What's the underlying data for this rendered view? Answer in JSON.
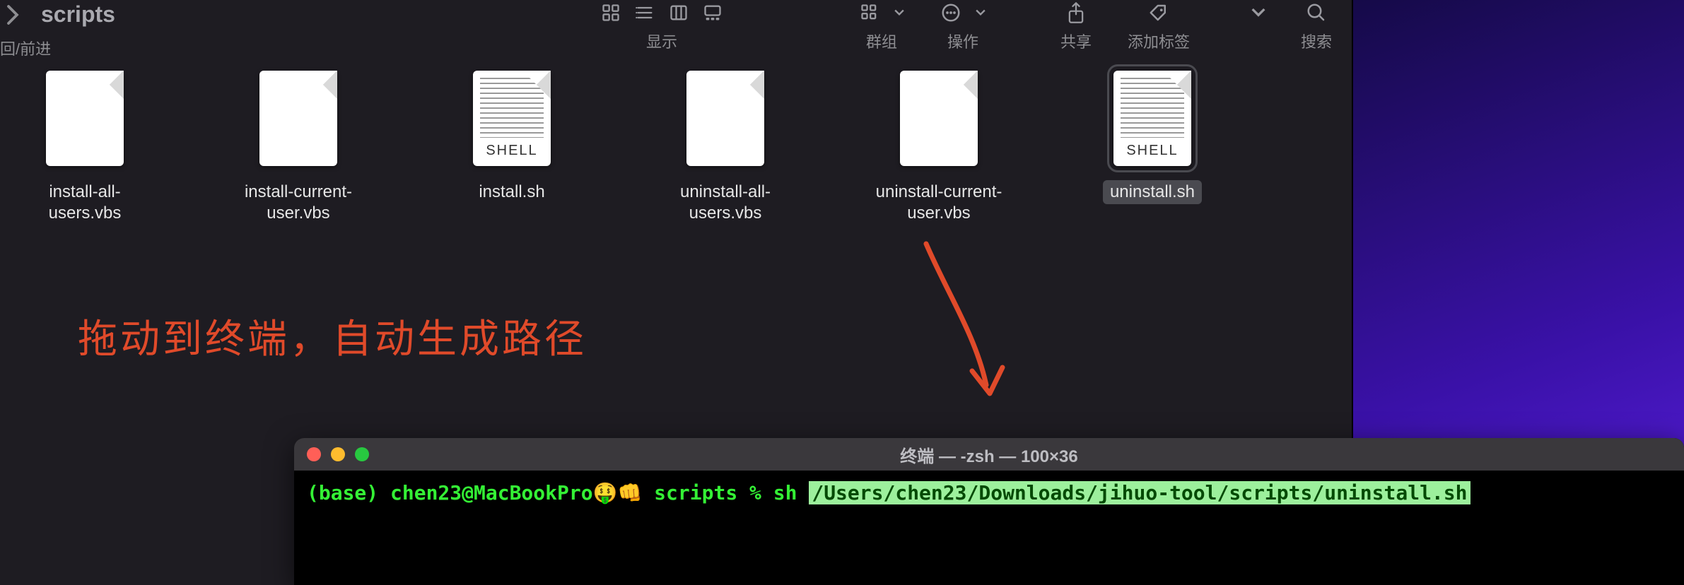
{
  "finder": {
    "folder_title": "scripts",
    "nav_caption": "回/前进",
    "groups": {
      "view": {
        "caption": "显示"
      },
      "group": {
        "caption": "群组"
      },
      "action": {
        "caption": "操作"
      },
      "share": {
        "caption": "共享"
      },
      "tags": {
        "caption": "添加标签"
      },
      "search": {
        "caption": "搜索"
      }
    }
  },
  "files": [
    {
      "name": "install-all-users.vbs",
      "type": "blank",
      "selected": false
    },
    {
      "name": "install-current-user.vbs",
      "type": "blank",
      "selected": false
    },
    {
      "name": "install.sh",
      "type": "shell",
      "badge": "SHELL",
      "selected": false
    },
    {
      "name": "uninstall-all-users.vbs",
      "type": "blank",
      "selected": false
    },
    {
      "name": "uninstall-current-user.vbs",
      "type": "blank",
      "selected": false
    },
    {
      "name": "uninstall.sh",
      "type": "shell",
      "badge": "SHELL",
      "selected": true
    }
  ],
  "annotation": {
    "text": "拖动到终端，自动生成路径"
  },
  "terminal": {
    "title": "终端 — -zsh — 100×36",
    "prompt_prefix": "(base) chen23@MacBookPro",
    "prompt_emoji": "🤑👊",
    "prompt_dir": "scripts",
    "prompt_symbol": "%",
    "command": "sh",
    "highlighted_path": "/Users/chen23/Downloads/jihuo-tool/scripts/uninstall.sh"
  }
}
